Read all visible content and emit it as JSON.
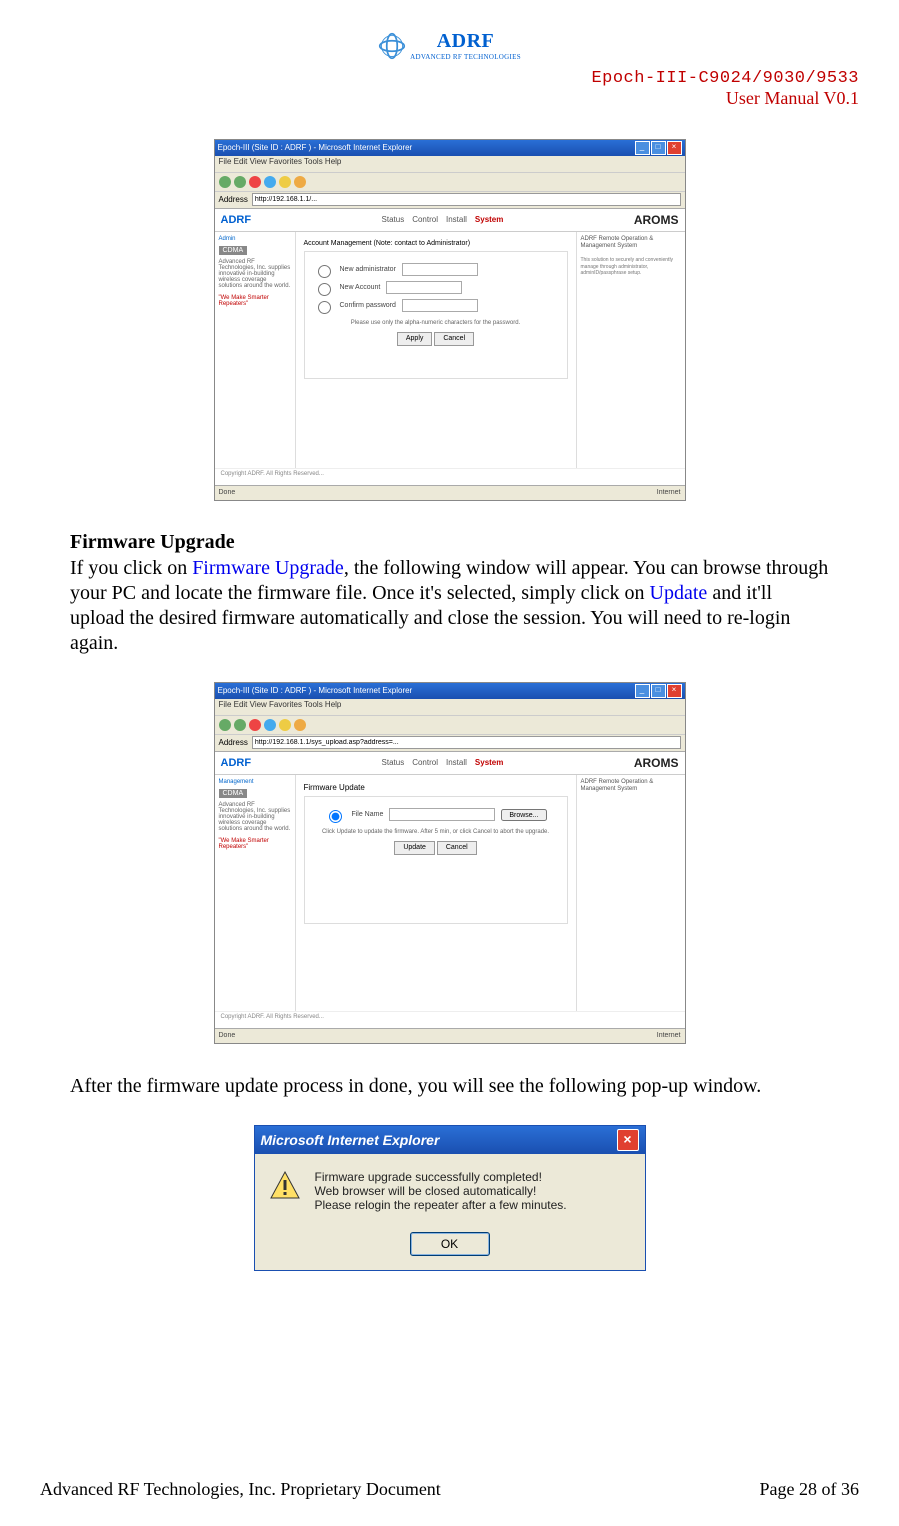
{
  "header": {
    "brand": "ADRF",
    "brand_tag": "ADVANCED RF TECHNOLOGIES",
    "line1": "Epoch-III-C9024/9030/9533",
    "line2": "User Manual V0.1"
  },
  "screenshot1": {
    "title": "Epoch-III (Site ID : ADRF ) - Microsoft Internet Explorer",
    "menu": "File   Edit   View   Favorites   Tools   Help",
    "addr_label": "Address",
    "addr_value": "http://192.168.1.1/...",
    "app_logo": "ADRF",
    "tabs": [
      "Status",
      "Control",
      "Install",
      "System"
    ],
    "app_title": "AROMS",
    "app_sub": "ADRF Remote Operation & Management System",
    "sidebar_link": "Admin",
    "sidebar_cdma": "CDMA",
    "sidebar_text": "Advanced RF Technologies, Inc. supplies innovative in-building wireless coverage solutions around the world.",
    "sidebar_slogan": "\"We Make Smarter Repeaters\"",
    "panel_title": "Account Management (Note: contact to Administrator)",
    "field1": "New administrator",
    "field2": "New Account",
    "field3": "Confirm password",
    "note": "Please use only the alpha-numeric characters for the password.",
    "btn1": "Apply",
    "btn2": "Cancel",
    "right_text": "This solution to securely and conveniently manage through administrator, adminID/passphrase setup.",
    "status_left": "Done",
    "status_right": "Internet"
  },
  "section": {
    "title": "Firmware Upgrade",
    "para1_a": "If you click on ",
    "para1_link1": "Firmware Upgrade",
    "para1_b": ", the following window will appear.  You can browse through your PC and locate the firmware file.  Once it's selected, simply click on ",
    "para1_link2": "Update",
    "para1_c": " and it'll upload the desired firmware automatically and close the session.  You will need to re-login again."
  },
  "screenshot2": {
    "title": "Epoch-III (Site ID : ADRF ) - Microsoft Internet Explorer",
    "menu": "File   Edit   View   Favorites   Tools   Help",
    "addr_label": "Address",
    "addr_value": "http://192.168.1.1/sys_upload.asp?address=...",
    "app_logo": "ADRF",
    "tabs": [
      "Status",
      "Control",
      "Install",
      "System"
    ],
    "app_title": "AROMS",
    "app_sub": "ADRF Remote Operation & Management System",
    "sidebar_link": "Management",
    "sidebar_cdma": "CDMA",
    "sidebar_text": "Advanced RF Technologies, Inc. supplies innovative in-building wireless coverage solutions around the world.",
    "sidebar_slogan": "\"We Make Smarter Repeaters\"",
    "panel_title": "Firmware Update",
    "file_label": "File Name",
    "browse_btn": "Browse...",
    "note": "Click Update to update the firmware. After 5 min, or click Cancel to abort the upgrade.",
    "btn1": "Update",
    "btn2": "Cancel",
    "status_left": "Done",
    "status_right": "Internet"
  },
  "para2": "After the firmware update process in done, you will see the following pop-up window.",
  "popup": {
    "title": "Microsoft Internet Explorer",
    "line1": "Firmware upgrade successfully completed!",
    "line2": "Web browser will be closed automatically!",
    "line3": "Please relogin the repeater after a few minutes.",
    "ok": "OK"
  },
  "footer": {
    "left": "Advanced RF Technologies, Inc. Proprietary Document",
    "right": "Page 28 of 36"
  }
}
